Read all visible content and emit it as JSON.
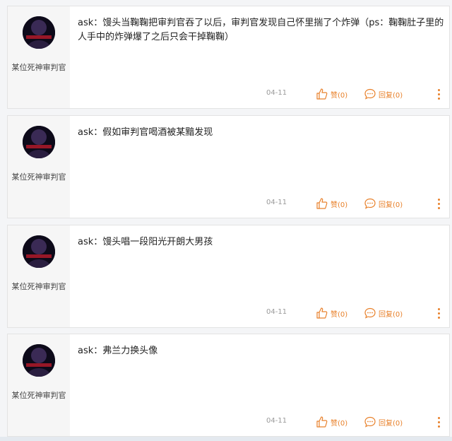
{
  "theme": {
    "accent": "#e8802a",
    "sidebar_bg": "#f6f6f6",
    "card_bg": "#ffffff"
  },
  "icons": {
    "like": "thumbs-up-icon",
    "reply": "speech-bubble-icon",
    "more": "vertical-dots-icon"
  },
  "posts": [
    {
      "author": "某位死神审判官",
      "content": "ask：馒头当鞠鞠把审判官吞了以后，审判官发现自己怀里揣了个炸弹（ps：鞠鞠肚子里的人手中的炸弹爆了之后只会干掉鞠鞠）",
      "date": "04-11",
      "like_label": "赞(0)",
      "reply_label": "回复(0)"
    },
    {
      "author": "某位死神审判官",
      "content": "ask：假如审判官喝酒被某黯发现",
      "date": "04-11",
      "like_label": "赞(0)",
      "reply_label": "回复(0)"
    },
    {
      "author": "某位死神审判官",
      "content": "ask：馒头唱一段阳光开朗大男孩",
      "date": "04-11",
      "like_label": "赞(0)",
      "reply_label": "回复(0)"
    },
    {
      "author": "某位死神审判官",
      "content": "ask：弗兰力换头像",
      "date": "04-11",
      "like_label": "赞(0)",
      "reply_label": "回复(0)"
    }
  ]
}
